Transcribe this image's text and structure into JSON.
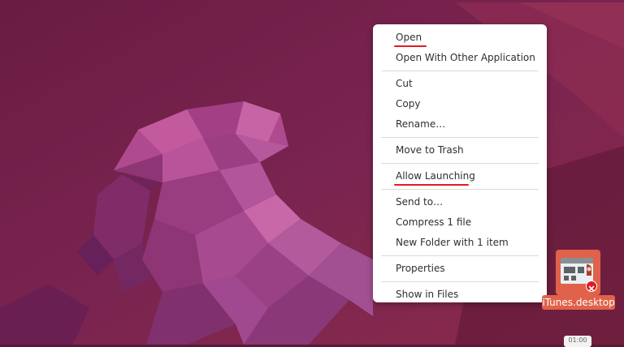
{
  "context_menu": {
    "items": [
      {
        "label": "Open"
      },
      {
        "label": "Open With Other Application"
      },
      {
        "label": "Cut"
      },
      {
        "label": "Copy"
      },
      {
        "label": "Rename…"
      },
      {
        "label": "Move to Trash"
      },
      {
        "label": "Allow Launching"
      },
      {
        "label": "Send to…"
      },
      {
        "label": "Compress 1 file"
      },
      {
        "label": "New Folder with 1 item"
      },
      {
        "label": "Properties"
      },
      {
        "label": "Show in Files"
      }
    ]
  },
  "desktop": {
    "file_icon_label": "iTunes.desktop",
    "clock_text": "01:00"
  },
  "colors": {
    "wallpaper_dark": "#4a1230",
    "wallpaper_mid": "#7a2450",
    "jellyfish": "#9a3b7e",
    "accent_red": "#e01b24",
    "icon_orange": "#e0624a"
  }
}
